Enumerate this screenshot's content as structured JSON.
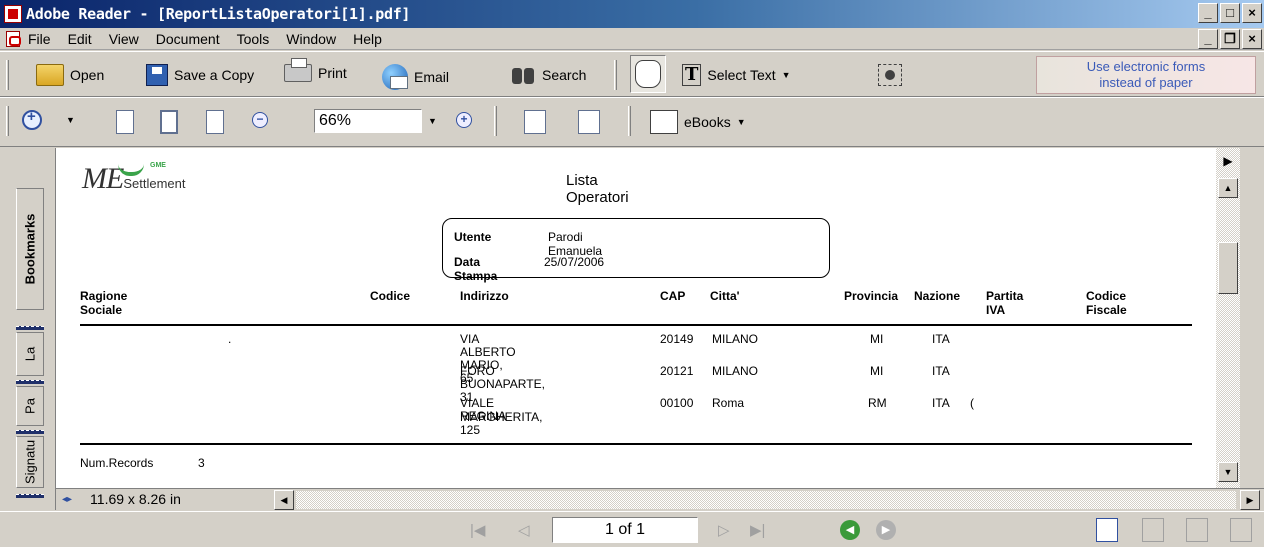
{
  "window": {
    "title": "Adobe Reader - [ReportListaOperatori[1].pdf]",
    "min": "_",
    "max": "□",
    "close": "×",
    "mdi_min": "_",
    "mdi_restore": "❐",
    "mdi_close": "×"
  },
  "menu": [
    "File",
    "Edit",
    "View",
    "Document",
    "Tools",
    "Window",
    "Help"
  ],
  "toolbar1": {
    "open": "Open",
    "save_copy": "Save a Copy",
    "print": "Print",
    "email": "Email",
    "search": "Search",
    "select_text": "Select Text",
    "ad_line1": "Use electronic forms",
    "ad_line2": "instead of paper"
  },
  "toolbar2": {
    "zoom_value": "66%",
    "ebooks": "eBooks"
  },
  "nav_tabs": [
    "Bookmarks",
    "La",
    "Pa",
    "Signatu"
  ],
  "document": {
    "title": "Lista Operatori",
    "logo_main": "ME",
    "logo_sub": "Settlement",
    "logo_tag": "GME",
    "utente_label": "Utente",
    "utente_value": "Parodi Emanuela",
    "data_label": "Data Stampa",
    "data_value": "25/07/2006",
    "columns": [
      "Ragione Sociale",
      "Codice",
      "Indirizzo",
      "CAP",
      "Citta'",
      "Provincia",
      "Nazione",
      "Partita IVA",
      "Codice Fiscale"
    ],
    "rows": [
      {
        "ragione": ".",
        "indirizzo": "VIA ALBERTO MARIO, 65",
        "cap": "20149",
        "citta": "MILANO",
        "provincia": "MI",
        "nazione": "ITA",
        "piva": ""
      },
      {
        "ragione": "",
        "indirizzo": "FORO BUONAPARTE, 31",
        "cap": "20121",
        "citta": "MILANO",
        "provincia": "MI",
        "nazione": "ITA",
        "piva": ""
      },
      {
        "ragione": "",
        "indirizzo_1": "VIALE REGINA",
        "indirizzo_2": "MARGHERITA, 125",
        "cap": "00100",
        "citta": "Roma",
        "provincia": "RM",
        "nazione": "ITA",
        "piva": "("
      }
    ],
    "num_records_label": "Num.Records",
    "num_records_value": "3"
  },
  "status": {
    "page_size": "11.69 x 8.26 in",
    "page_indicator": "1 of 1"
  }
}
